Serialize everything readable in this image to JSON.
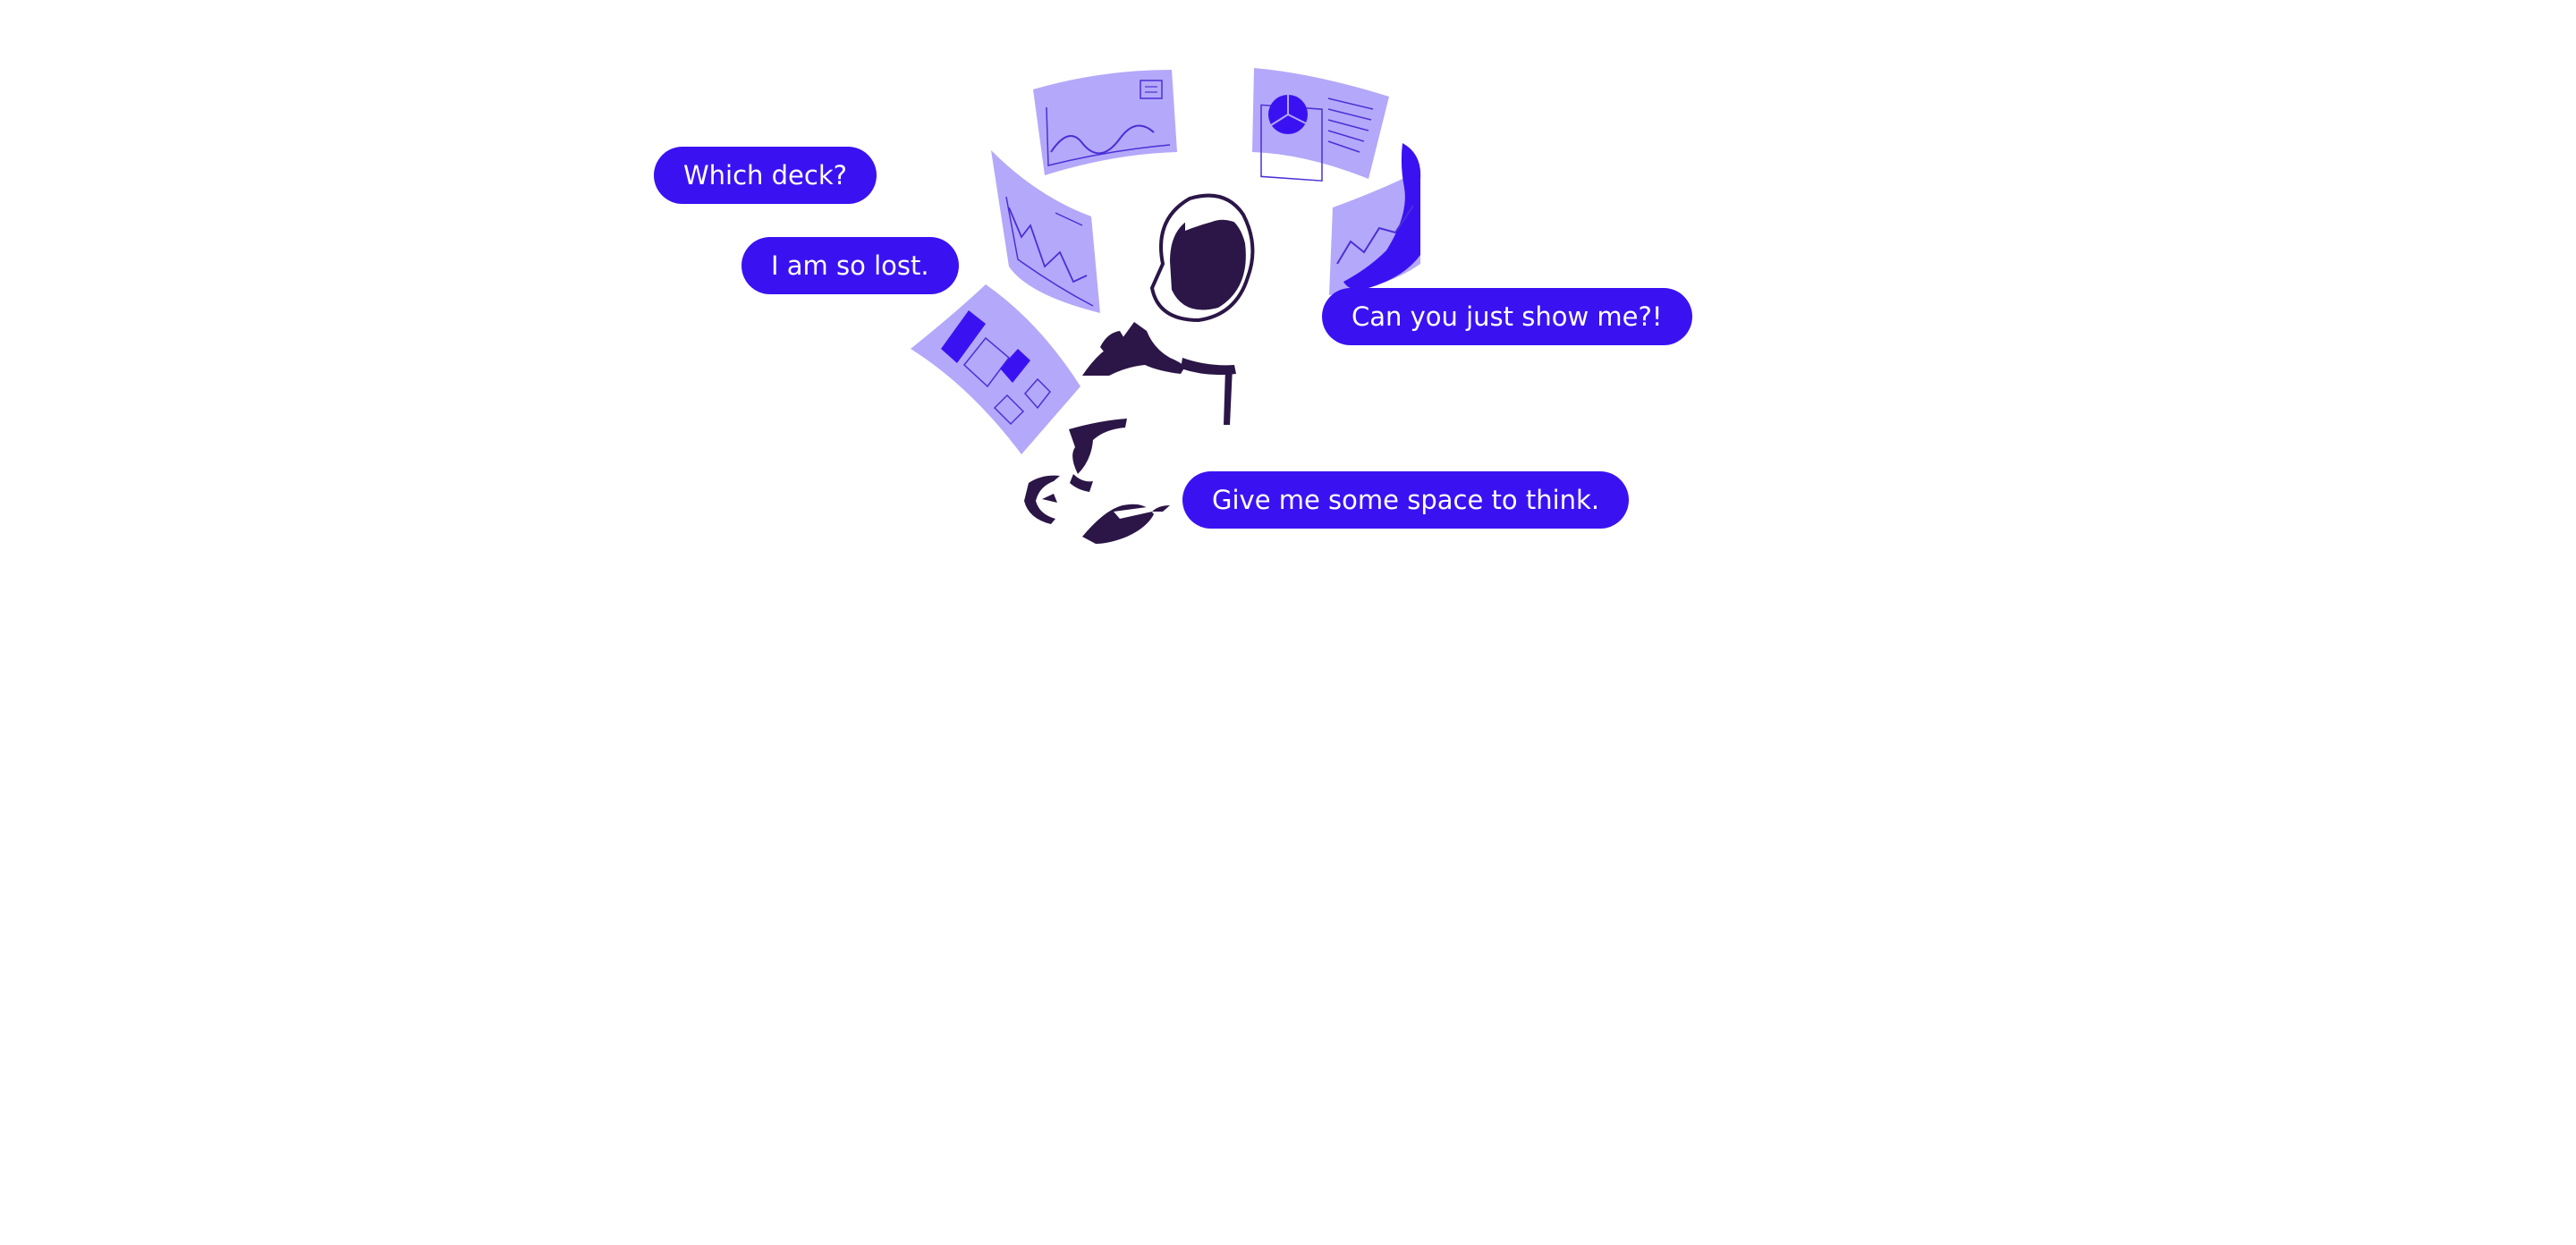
{
  "colors": {
    "bubble": "#3a12f2",
    "card": "#b4a8fa",
    "card_line": "#4b2fd6",
    "accent": "#3a12f2",
    "astronaut": "#2b1647",
    "background": "#ffffff"
  },
  "bubbles": [
    {
      "text": "Which deck?"
    },
    {
      "text": "I am so lost."
    },
    {
      "text": "Can you just show me?!"
    },
    {
      "text": "Give me some space to think."
    }
  ],
  "illustration": {
    "subject": "astronaut-icon",
    "cards": [
      "wave-chart-card",
      "pie-chart-card",
      "line-chart-card",
      "trend-chart-card",
      "layout-card"
    ]
  }
}
